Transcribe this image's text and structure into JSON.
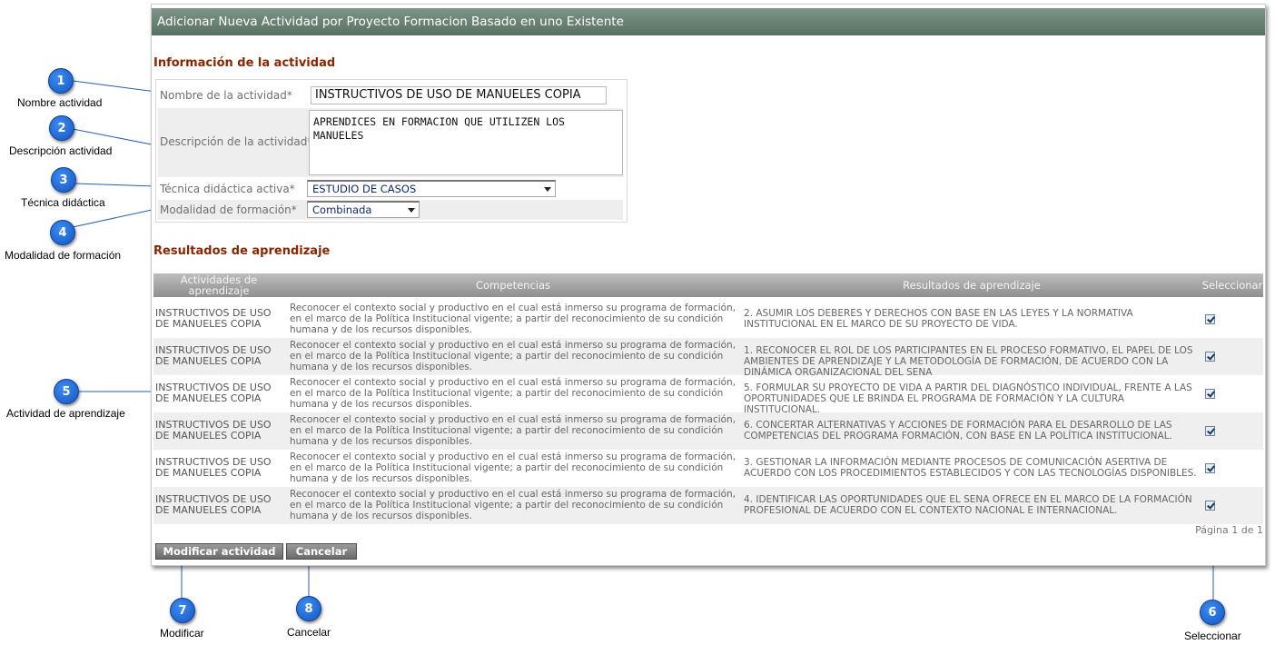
{
  "window": {
    "title": "Adicionar Nueva Actividad por Proyecto Formacion Basado en uno Existente"
  },
  "sections": {
    "activity_info": "Información de la actividad",
    "learning_results": "Resultados de aprendizaje"
  },
  "form": {
    "name_label": "Nombre de la actividad*",
    "name_value": "INSTRUCTIVOS DE USO DE MANUELES COPIA",
    "desc_label": "Descripción de la actividad*",
    "desc_value": "APRENDICES EN FORMACION QUE UTILIZEN LOS MANUELES",
    "technique_label": "Técnica didáctica activa*",
    "technique_value": "ESTUDIO DE CASOS",
    "modality_label": "Modalidad de formación*",
    "modality_value": "Combinada"
  },
  "table": {
    "headers": {
      "activities": "Actividades de aprendizaje",
      "competencies": "Competencias",
      "results": "Resultados de aprendizaje",
      "select": "Seleccionar"
    },
    "rows": [
      {
        "activity": "INSTRUCTIVOS DE USO DE MANUELES COPIA",
        "competency": "Reconocer el contexto social y productivo en el cual está inmerso su programa de formación, en el marco de la Política Institucional vigente; a partir del reconocimiento de su condición humana y de los recursos disponibles.",
        "result": "2. ASUMIR LOS DEBERES Y DERECHOS CON BASE EN LAS LEYES Y LA NORMATIVA INSTITUCIONAL EN EL MARCO DE SU PROYECTO DE VIDA.",
        "selected": true
      },
      {
        "activity": "INSTRUCTIVOS DE USO DE MANUELES COPIA",
        "competency": "Reconocer el contexto social y productivo en el cual está inmerso su programa de formación, en el marco de la Política Institucional vigente; a partir del reconocimiento de su condición humana y de los recursos disponibles.",
        "result": "1. RECONOCER EL ROL DE LOS PARTICIPANTES EN EL PROCESO FORMATIVO, EL PAPEL DE LOS AMBIENTES DE APRENDIZAJE Y LA METODOLOGÍA DE FORMACIÓN, DE ACUERDO CON LA DINÁMICA ORGANIZACIONAL DEL SENA",
        "selected": true
      },
      {
        "activity": "INSTRUCTIVOS DE USO DE MANUELES COPIA",
        "competency": "Reconocer el contexto social y productivo en el cual está inmerso su programa de formación, en el marco de la Política Institucional vigente; a partir del reconocimiento de su condición humana y de los recursos disponibles.",
        "result": "5. FORMULAR SU PROYECTO DE VIDA A PARTIR DEL DIAGNÓSTICO INDIVIDUAL, FRENTE A LAS OPORTUNIDADES QUE LE BRINDA EL PROGRAMA DE FORMACIÓN Y LA CULTURA INSTITUCIONAL.",
        "selected": true
      },
      {
        "activity": "INSTRUCTIVOS DE USO DE MANUELES COPIA",
        "competency": "Reconocer el contexto social y productivo en el cual está inmerso su programa de formación, en el marco de la Política Institucional vigente; a partir del reconocimiento de su condición humana y de los recursos disponibles.",
        "result": "6. CONCERTAR ALTERNATIVAS Y ACCIONES DE FORMACIÓN PARA EL DESARROLLO DE LAS COMPETENCIAS DEL PROGRAMA FORMACIÓN, CON BASE EN LA POLÍTICA INSTITUCIONAL.",
        "selected": true
      },
      {
        "activity": "INSTRUCTIVOS DE USO DE MANUELES COPIA",
        "competency": "Reconocer el contexto social y productivo en el cual está inmerso su programa de formación, en el marco de la Política Institucional vigente; a partir del reconocimiento de su condición humana y de los recursos disponibles.",
        "result": "3. GESTIONAR LA INFORMACIÓN MEDIANTE PROCESOS DE COMUNICACIÓN ASERTIVA DE ACUERDO CON LOS PROCEDIMIENTOS ESTABLECIDOS Y CON LAS TECNOLOGÍAS DISPONIBLES.",
        "selected": true
      },
      {
        "activity": "INSTRUCTIVOS DE USO DE MANUELES COPIA",
        "competency": "Reconocer el contexto social y productivo en el cual está inmerso su programa de formación, en el marco de la Política Institucional vigente; a partir del reconocimiento de su condición humana y de los recursos disponibles.",
        "result": "4. IDENTIFICAR LAS OPORTUNIDADES QUE EL SENA OFRECE EN EL MARCO DE LA FORMACIÓN PROFESIONAL DE ACUERDO CON EL CONTEXTO NACIONAL E INTERNACIONAL.",
        "selected": true
      }
    ],
    "pager": "Página 1 de 1"
  },
  "buttons": {
    "modify": "Modificar actividad",
    "cancel": "Cancelar"
  },
  "callouts": [
    {
      "number": "1",
      "label": "Nombre actividad"
    },
    {
      "number": "2",
      "label": "Descripción actividad"
    },
    {
      "number": "3",
      "label": "Técnica didáctica"
    },
    {
      "number": "4",
      "label": "Modalidad de formación"
    },
    {
      "number": "5",
      "label": "Actividad de aprendizaje"
    },
    {
      "number": "6",
      "label": "Seleccionar"
    },
    {
      "number": "7",
      "label": "Modificar"
    },
    {
      "number": "8",
      "label": "Cancelar"
    }
  ],
  "colors": {
    "title_bar": "#587262",
    "section_heading": "#8b2500",
    "callout": "#1a66d9"
  }
}
